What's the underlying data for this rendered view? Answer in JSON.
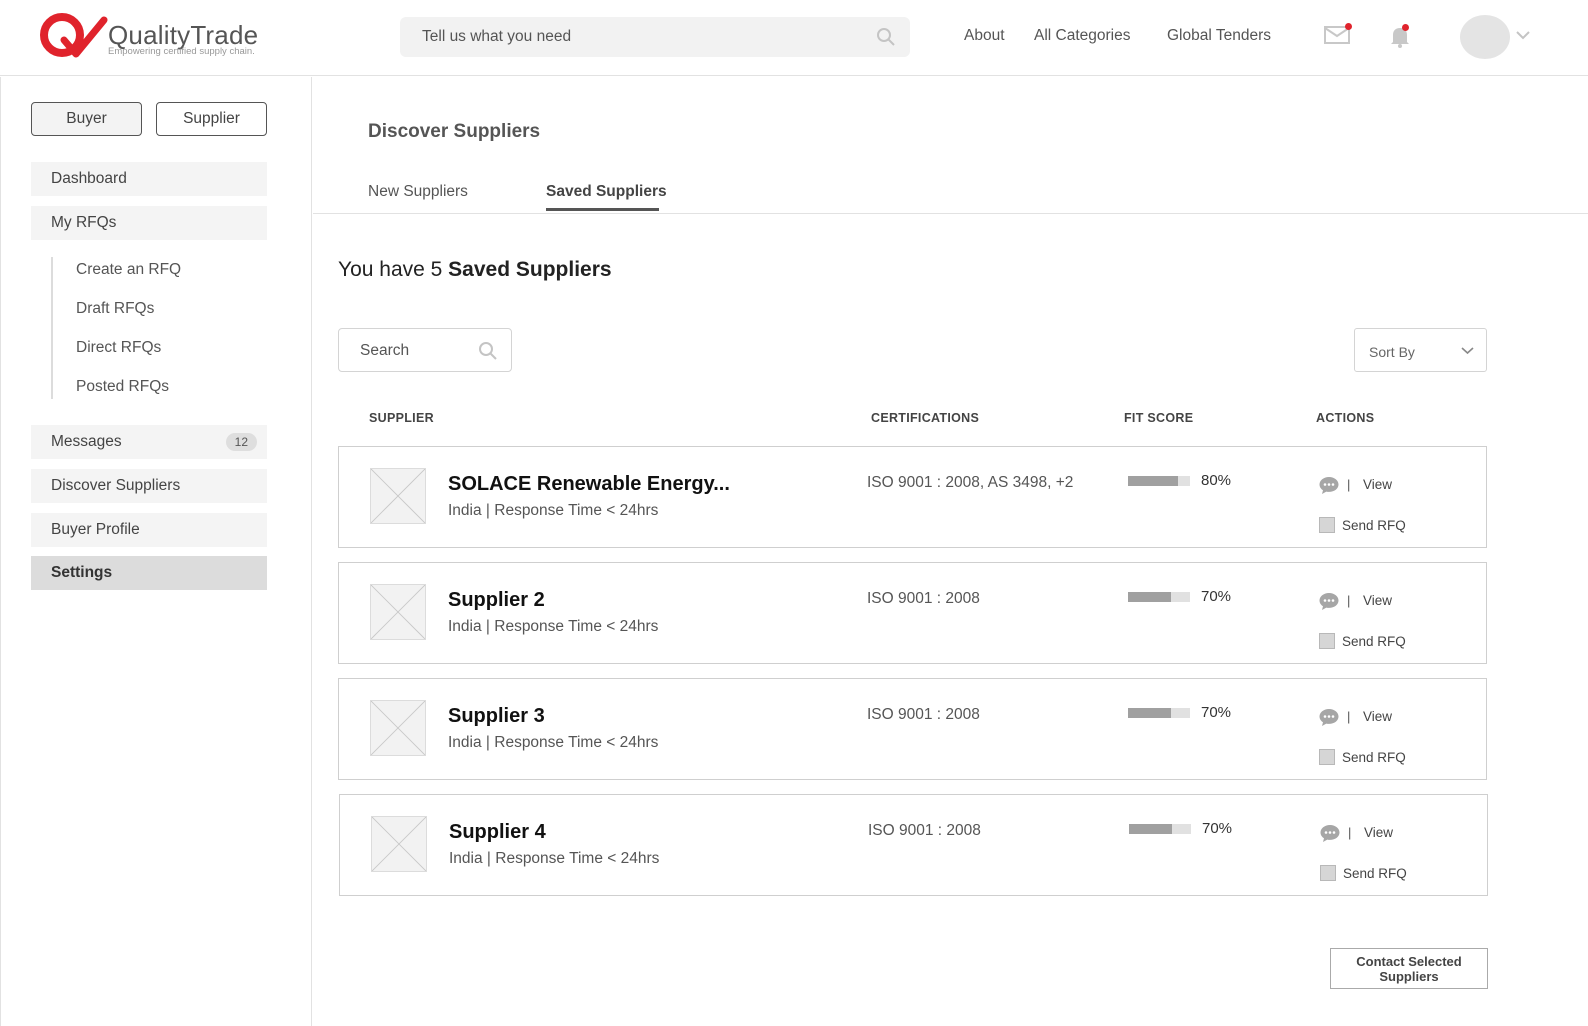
{
  "brand": {
    "name": "QualityTrade",
    "tagline": "Empowering certified supply chain."
  },
  "header": {
    "search_placeholder": "Tell us what you need",
    "nav": [
      "About",
      "All Categories",
      "Global Tenders"
    ]
  },
  "sidebar": {
    "roles": [
      "Buyer",
      "Supplier"
    ],
    "items": {
      "dashboard": "Dashboard",
      "my_rfqs": "My RFQs",
      "messages": "Messages",
      "messages_count": "12",
      "discover": "Discover Suppliers",
      "profile": "Buyer Profile",
      "settings": "Settings"
    },
    "rfq_sub": [
      "Create an RFQ",
      "Draft RFQs",
      "Direct RFQs",
      "Posted RFQs"
    ]
  },
  "main": {
    "title": "Discover Suppliers",
    "tabs": [
      "New Suppliers",
      "Saved Suppliers"
    ],
    "count_prefix": "You have 5",
    "count_bold": "Saved Suppliers",
    "search_placeholder": "Search",
    "sort_label": "Sort By",
    "columns": [
      "SUPPLIER",
      "CERTIFICATIONS",
      "FIT SCORE",
      "ACTIONS"
    ],
    "view_label": "View",
    "action_sep": "|",
    "send_rfq_label": "Send RFQ",
    "contact_button": "Contact Selected Suppliers",
    "suppliers": [
      {
        "name": "SOLACE Renewable Energy...",
        "meta": "India  |  Response Time < 24hrs",
        "certifications": "ISO 9001 : 2008, AS 3498, +2",
        "fit_score": "80%",
        "fit_value": 0.8
      },
      {
        "name": "Supplier 2",
        "meta": "India  |  Response Time < 24hrs",
        "certifications": "ISO 9001 : 2008",
        "fit_score": "70%",
        "fit_value": 0.7
      },
      {
        "name": "Supplier 3",
        "meta": "India  |  Response Time < 24hrs",
        "certifications": "ISO 9001 : 2008",
        "fit_score": "70%",
        "fit_value": 0.7
      },
      {
        "name": "Supplier 4",
        "meta": "India  |  Response Time < 24hrs",
        "certifications": "ISO 9001 : 2008",
        "fit_score": "70%",
        "fit_value": 0.7
      }
    ]
  },
  "colors": {
    "brand_red": "#e0232c",
    "notification_dot": "#e0232c",
    "fit_fill": "#a0a0a0"
  }
}
